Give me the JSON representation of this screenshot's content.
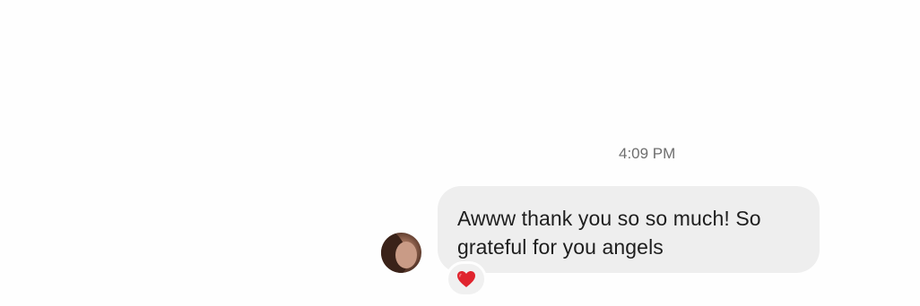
{
  "conversation": {
    "timestamp": "4:09 PM",
    "messages": [
      {
        "text": "Awww thank you so so much! So grateful for you angels",
        "line1": "Awww thank you so so much! So",
        "line2": "grateful for you angels",
        "reaction": "heart-icon"
      }
    ]
  },
  "colors": {
    "background": "#fefefe",
    "bubble": "#eeeeee",
    "timestamp_text": "#6e6e6e",
    "message_text": "#1e1e1e",
    "heart": "#e0242e"
  }
}
